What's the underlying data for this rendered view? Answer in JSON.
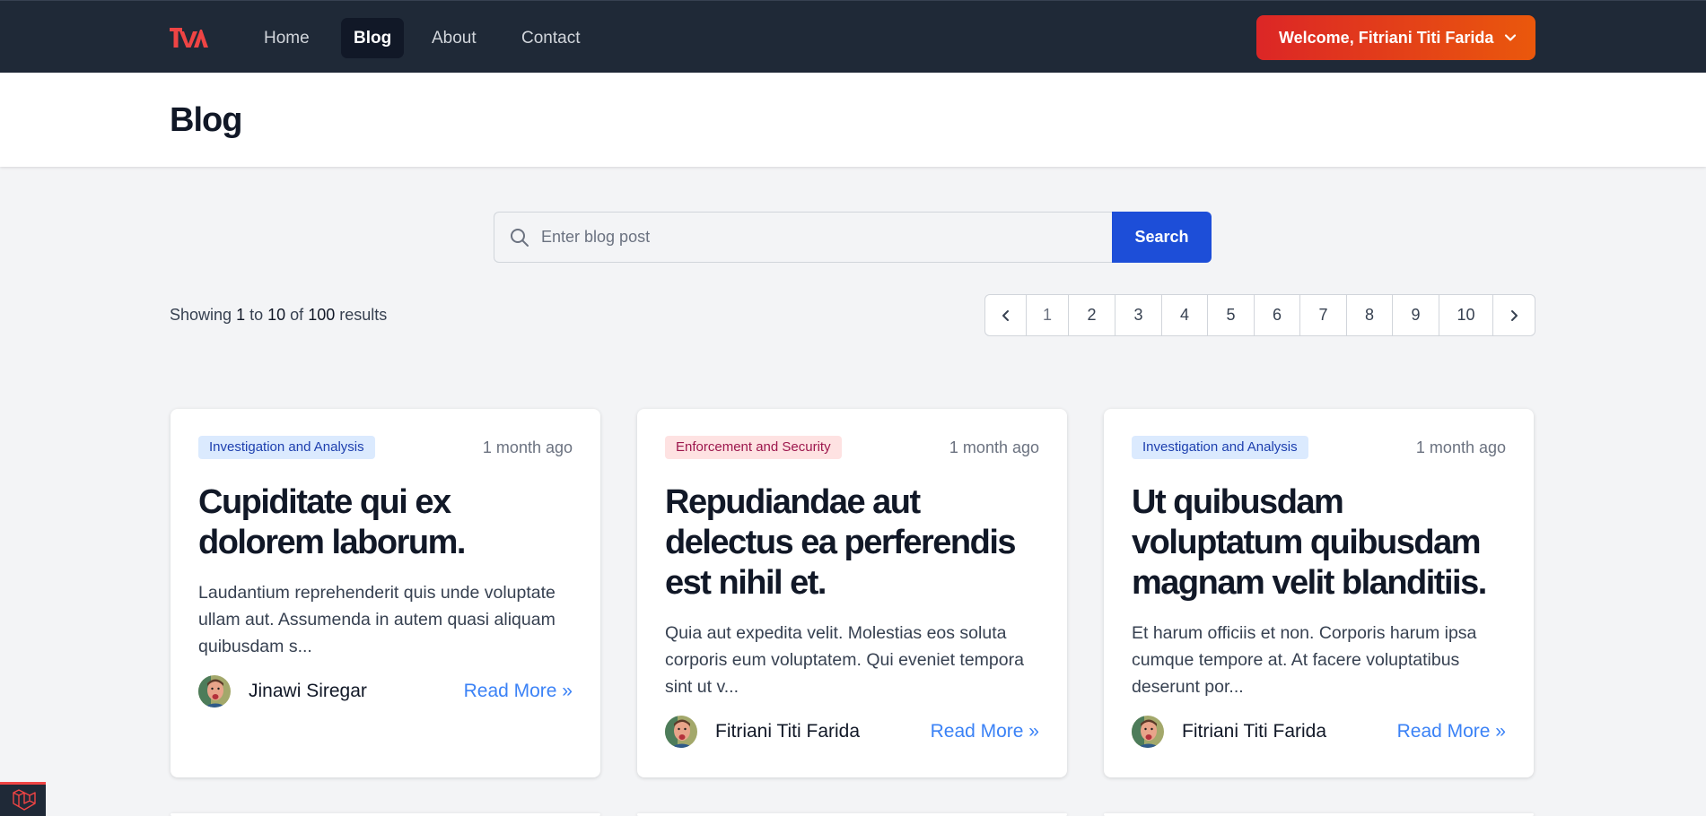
{
  "nav": {
    "logo_text": "TVA",
    "links": [
      {
        "label": "Home",
        "active": false
      },
      {
        "label": "Blog",
        "active": true
      },
      {
        "label": "About",
        "active": false
      },
      {
        "label": "Contact",
        "active": false
      }
    ],
    "welcome_label": "Welcome, Fitriani Titi Farida"
  },
  "header": {
    "title": "Blog"
  },
  "search": {
    "placeholder": "Enter blog post",
    "value": "",
    "button_label": "Search"
  },
  "results": {
    "prefix": "Showing",
    "from": "1",
    "to_word": "to",
    "to": "10",
    "of_word": "of",
    "total": "100",
    "suffix": "results"
  },
  "pagination": {
    "pages": [
      "1",
      "2",
      "3",
      "4",
      "5",
      "6",
      "7",
      "8",
      "9",
      "10"
    ],
    "current": "1"
  },
  "posts": [
    {
      "category": "Investigation and Analysis",
      "category_color": "#dbeafe",
      "time": "1 month ago",
      "title": "Cupiditate qui ex dolorem laborum.",
      "excerpt": "Laudantium reprehenderit quis unde voluptate ullam aut. Assumenda in autem quasi aliquam quibusdam s...",
      "author": "Jinawi Siregar",
      "read_more": "Read More »"
    },
    {
      "category": "Enforcement and Security",
      "category_color": "#fee2e2",
      "time": "1 month ago",
      "title": "Repudiandae aut delectus ea perferendis est nihil et.",
      "excerpt": "Quia aut expedita velit. Molestias eos soluta corporis eum voluptatem. Qui eveniet tempora sint ut v...",
      "author": "Fitriani Titi Farida",
      "read_more": "Read More »"
    },
    {
      "category": "Investigation and Analysis",
      "category_color": "#dbeafe",
      "time": "1 month ago",
      "title": "Ut quibusdam voluptatum quibusdam magnam velit blanditiis.",
      "excerpt": "Et harum officiis et non. Corporis harum ipsa cumque tempore at. At facere voluptatibus deserunt por...",
      "author": "Fitriani Titi Farida",
      "read_more": "Read More »"
    }
  ],
  "colors": {
    "nav_bg": "#1f2937",
    "accent_gradient_start": "#dc2626",
    "accent_gradient_end": "#ea580c",
    "primary": "#1d4ed8",
    "link": "#3b82f6"
  }
}
